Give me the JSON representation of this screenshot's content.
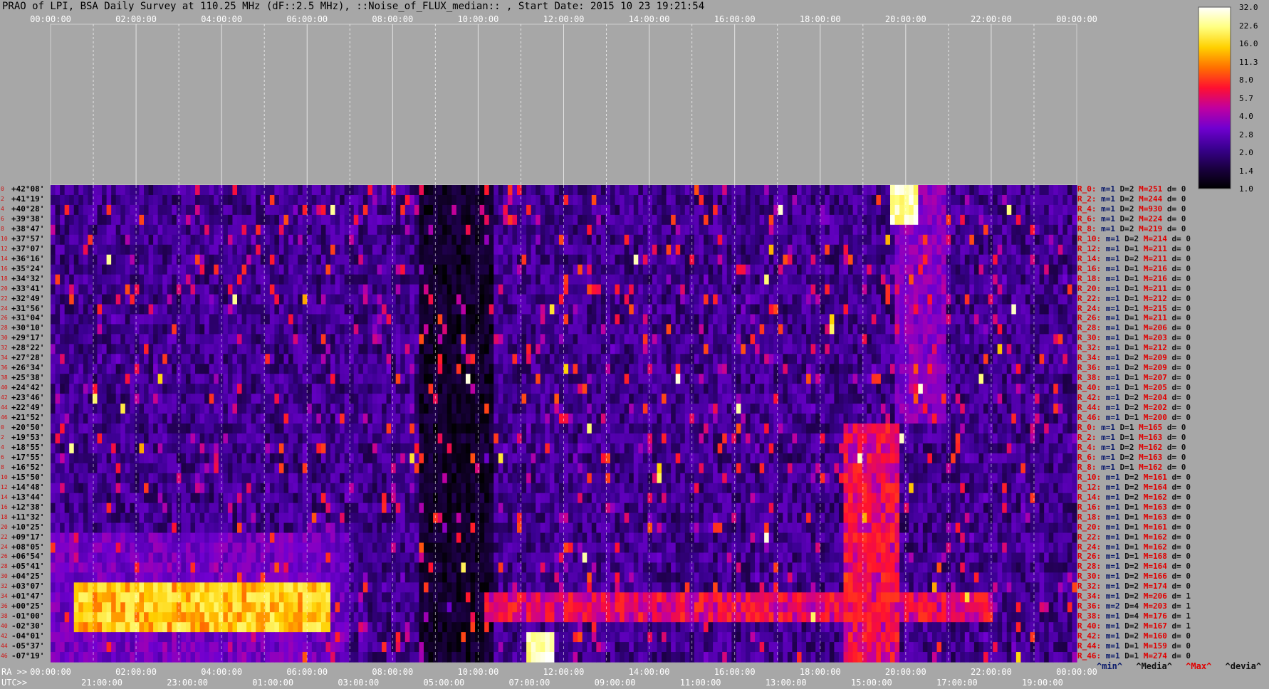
{
  "title": "PRAO of LPI, BSA Daily Survey at 110.25 MHz (dF::2.5 MHz), ::Noise_of_FLUX_median:: , Start Date: 2015 10 23 19:21:54",
  "top_axis_labels": [
    "00:00:00",
    "02:00:00",
    "04:00:00",
    "06:00:00",
    "08:00:00",
    "10:00:00",
    "12:00:00",
    "14:00:00",
    "16:00:00",
    "18:00:00",
    "20:00:00",
    "22:00:00",
    "00:00:00"
  ],
  "ra_prefix": "RA >>",
  "ra_axis_labels": [
    "00:00:00",
    "02:00:00",
    "04:00:00",
    "06:00:00",
    "08:00:00",
    "10:00:00",
    "12:00:00",
    "14:00:00",
    "16:00:00",
    "18:00:00",
    "20:00:00",
    "22:00:00",
    "00:00:00"
  ],
  "utc_prefix": "UTC>>",
  "utc_axis_labels": [
    "21:00:00",
    "23:00:00",
    "01:00:00",
    "03:00:00",
    "05:00:00",
    "07:00:00",
    "09:00:00",
    "11:00:00",
    "13:00:00",
    "15:00:00",
    "17:00:00",
    "19:00:00"
  ],
  "declinations": [
    "+42°08'",
    "+41°19'",
    "+40°28'",
    "+39°38'",
    "+38°47'",
    "+37°57'",
    "+37°07'",
    "+36°16'",
    "+35°24'",
    "+34°32'",
    "+33°41'",
    "+32°49'",
    "+31°56'",
    "+31°04'",
    "+30°10'",
    "+29°17'",
    "+28°22'",
    "+27°28'",
    "+26°34'",
    "+25°38'",
    "+24°42'",
    "+23°46'",
    "+22°49'",
    "+21°52'",
    "+20°50'",
    "+19°53'",
    "+18°55'",
    "+17°55'",
    "+16°52'",
    "+15°50'",
    "+14°48'",
    "+13°44'",
    "+12°38'",
    "+11°32'",
    "+10°25'",
    "+09°17'",
    "+08°05'",
    "+06°54'",
    "+05°41'",
    "+04°25'",
    "+03°07'",
    "+01°47'",
    "+00°25'",
    "-01°00'",
    "-02°30'",
    "-04°01'",
    "-05°37'",
    "-07°19'"
  ],
  "row_numbers": [
    "0",
    "2",
    "4",
    "6",
    "8",
    "10",
    "12",
    "14",
    "16",
    "18",
    "20",
    "22",
    "24",
    "26",
    "28",
    "30",
    "32",
    "34",
    "36",
    "38",
    "40",
    "42",
    "44",
    "46",
    "0",
    "2",
    "4",
    "6",
    "8",
    "10",
    "12",
    "14",
    "16",
    "18",
    "20",
    "22",
    "24",
    "26",
    "28",
    "30",
    "32",
    "34",
    "36",
    "38",
    "40",
    "42",
    "44",
    "46"
  ],
  "stats": [
    {
      "r": "R_0:",
      "min": "m=1",
      "dev": "D=2",
      "max": "M=251",
      "d": "d= 0"
    },
    {
      "r": "R_2:",
      "min": "m=1",
      "dev": "D=2",
      "max": "M=244",
      "d": "d= 0"
    },
    {
      "r": "R_4:",
      "min": "m=1",
      "dev": "D=2",
      "max": "M=930",
      "d": "d= 0"
    },
    {
      "r": "R_6:",
      "min": "m=1",
      "dev": "D=2",
      "max": "M=224",
      "d": "d= 0"
    },
    {
      "r": "R_8:",
      "min": "m=1",
      "dev": "D=2",
      "max": "M=219",
      "d": "d= 0"
    },
    {
      "r": "R_10:",
      "min": "m=1",
      "dev": "D=2",
      "max": "M=214",
      "d": "d= 0"
    },
    {
      "r": "R_12:",
      "min": "m=1",
      "dev": "D=1",
      "max": "M=211",
      "d": "d= 0"
    },
    {
      "r": "R_14:",
      "min": "m=1",
      "dev": "D=2",
      "max": "M=211",
      "d": "d= 0"
    },
    {
      "r": "R_16:",
      "min": "m=1",
      "dev": "D=1",
      "max": "M=216",
      "d": "d= 0"
    },
    {
      "r": "R_18:",
      "min": "m=1",
      "dev": "D=1",
      "max": "M=216",
      "d": "d= 0"
    },
    {
      "r": "R_20:",
      "min": "m=1",
      "dev": "D=1",
      "max": "M=211",
      "d": "d= 0"
    },
    {
      "r": "R_22:",
      "min": "m=1",
      "dev": "D=1",
      "max": "M=212",
      "d": "d= 0"
    },
    {
      "r": "R_24:",
      "min": "m=1",
      "dev": "D=1",
      "max": "M=215",
      "d": "d= 0"
    },
    {
      "r": "R_26:",
      "min": "m=1",
      "dev": "D=1",
      "max": "M=211",
      "d": "d= 0"
    },
    {
      "r": "R_28:",
      "min": "m=1",
      "dev": "D=1",
      "max": "M=206",
      "d": "d= 0"
    },
    {
      "r": "R_30:",
      "min": "m=1",
      "dev": "D=1",
      "max": "M=203",
      "d": "d= 0"
    },
    {
      "r": "R_32:",
      "min": "m=1",
      "dev": "D=1",
      "max": "M=212",
      "d": "d= 0"
    },
    {
      "r": "R_34:",
      "min": "m=1",
      "dev": "D=2",
      "max": "M=209",
      "d": "d= 0"
    },
    {
      "r": "R_36:",
      "min": "m=1",
      "dev": "D=2",
      "max": "M=209",
      "d": "d= 0"
    },
    {
      "r": "R_38:",
      "min": "m=1",
      "dev": "D=1",
      "max": "M=207",
      "d": "d= 0"
    },
    {
      "r": "R_40:",
      "min": "m=1",
      "dev": "D=1",
      "max": "M=205",
      "d": "d= 0"
    },
    {
      "r": "R_42:",
      "min": "m=1",
      "dev": "D=2",
      "max": "M=204",
      "d": "d= 0"
    },
    {
      "r": "R_44:",
      "min": "m=1",
      "dev": "D=2",
      "max": "M=202",
      "d": "d= 0"
    },
    {
      "r": "R_46:",
      "min": "m=1",
      "dev": "D=1",
      "max": "M=200",
      "d": "d= 0"
    },
    {
      "r": "R_0:",
      "min": "m=1",
      "dev": "D=1",
      "max": "M=165",
      "d": "d= 0"
    },
    {
      "r": "R_2:",
      "min": "m=1",
      "dev": "D=1",
      "max": "M=163",
      "d": "d= 0"
    },
    {
      "r": "R_4:",
      "min": "m=1",
      "dev": "D=2",
      "max": "M=162",
      "d": "d= 0"
    },
    {
      "r": "R_6:",
      "min": "m=1",
      "dev": "D=2",
      "max": "M=163",
      "d": "d= 0"
    },
    {
      "r": "R_8:",
      "min": "m=1",
      "dev": "D=1",
      "max": "M=162",
      "d": "d= 0"
    },
    {
      "r": "R_10:",
      "min": "m=1",
      "dev": "D=2",
      "max": "M=161",
      "d": "d= 0"
    },
    {
      "r": "R_12:",
      "min": "m=1",
      "dev": "D=2",
      "max": "M=164",
      "d": "d= 0"
    },
    {
      "r": "R_14:",
      "min": "m=1",
      "dev": "D=2",
      "max": "M=162",
      "d": "d= 0"
    },
    {
      "r": "R_16:",
      "min": "m=1",
      "dev": "D=1",
      "max": "M=163",
      "d": "d= 0"
    },
    {
      "r": "R_18:",
      "min": "m=1",
      "dev": "D=1",
      "max": "M=163",
      "d": "d= 0"
    },
    {
      "r": "R_20:",
      "min": "m=1",
      "dev": "D=1",
      "max": "M=161",
      "d": "d= 0"
    },
    {
      "r": "R_22:",
      "min": "m=1",
      "dev": "D=1",
      "max": "M=162",
      "d": "d= 0"
    },
    {
      "r": "R_24:",
      "min": "m=1",
      "dev": "D=1",
      "max": "M=162",
      "d": "d= 0"
    },
    {
      "r": "R_26:",
      "min": "m=1",
      "dev": "D=1",
      "max": "M=168",
      "d": "d= 0"
    },
    {
      "r": "R_28:",
      "min": "m=1",
      "dev": "D=2",
      "max": "M=164",
      "d": "d= 0"
    },
    {
      "r": "R_30:",
      "min": "m=1",
      "dev": "D=2",
      "max": "M=166",
      "d": "d= 0"
    },
    {
      "r": "R_32:",
      "min": "m=1",
      "dev": "D=2",
      "max": "M=174",
      "d": "d= 0"
    },
    {
      "r": "R_34:",
      "min": "m=1",
      "dev": "D=2",
      "max": "M=206",
      "d": "d= 1"
    },
    {
      "r": "R_36:",
      "min": "m=2",
      "dev": "D=4",
      "max": "M=203",
      "d": "d= 1"
    },
    {
      "r": "R_38:",
      "min": "m=1",
      "dev": "D=4",
      "max": "M=176",
      "d": "d= 1"
    },
    {
      "r": "R_40:",
      "min": "m=1",
      "dev": "D=2",
      "max": "M=167",
      "d": "d= 1"
    },
    {
      "r": "R_42:",
      "min": "m=1",
      "dev": "D=2",
      "max": "M=160",
      "d": "d= 0"
    },
    {
      "r": "R_44:",
      "min": "m=1",
      "dev": "D=1",
      "max": "M=159",
      "d": "d= 0"
    },
    {
      "r": "R_46:",
      "min": "m=1",
      "dev": "D=1",
      "max": "M=274",
      "d": "d= 0"
    }
  ],
  "stats_legend": {
    "min": "^min^",
    "median": "^Media^",
    "max": "^Max^",
    "dev": "^devia^"
  },
  "colorbar": {
    "ticks": [
      "32.0",
      "22.6",
      "16.0",
      "11.3",
      "8.0",
      "5.7",
      "4.0",
      "2.8",
      "2.0",
      "1.4",
      "1.0"
    ],
    "colors": [
      "#000000",
      "#1a0040",
      "#3a0090",
      "#7000d0",
      "#c000a0",
      "#ff1030",
      "#ff7000",
      "#ffd000",
      "#ffff80",
      "#ffffff"
    ]
  },
  "chart_data": {
    "type": "heatmap",
    "title": "PRAO of LPI, BSA Daily Survey at 110.25 MHz (dF::2.5 MHz), ::Noise_of_FLUX_median:: , Start Date: 2015 10 23 19:21:54",
    "x_ra_range": [
      "00:00:00",
      "24:00:00"
    ],
    "y_declination_range": [
      "+42°08'",
      "-07°19'"
    ],
    "rows": 48,
    "value_range": [
      1.0,
      32.0
    ],
    "scale": "log",
    "features": [
      {
        "ra_start_h": 0.6,
        "ra_end_h": 6.6,
        "dec_row_start": 40,
        "dec_row_end": 44,
        "level": 18
      },
      {
        "ra_start_h": 10.2,
        "ra_end_h": 22.0,
        "dec_row_start": 41,
        "dec_row_end": 43,
        "level": 7
      },
      {
        "ra_start_h": 18.6,
        "ra_end_h": 19.9,
        "dec_row_start": 24,
        "dec_row_end": 47,
        "level": 7
      },
      {
        "ra_center_h": 19.95,
        "dec_row": 1,
        "level": 32
      },
      {
        "ra_center_h": 11.45,
        "dec_row": 47,
        "level": 32
      }
    ]
  }
}
